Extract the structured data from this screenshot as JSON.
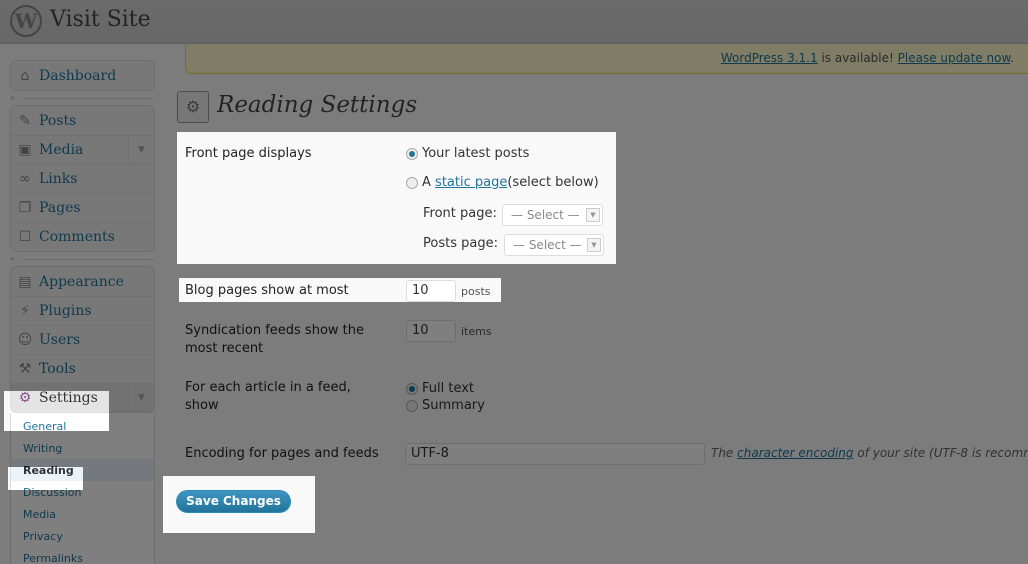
{
  "header": {
    "logo": "W",
    "site_title": "Visit Site"
  },
  "update_nag": {
    "version_link": "WordPress 3.1.1",
    "middle_text": " is available! ",
    "update_link": "Please update now",
    "end": "."
  },
  "sidebar": {
    "dashboard": {
      "label": "Dashboard",
      "icon": "⌂"
    },
    "group1": [
      {
        "label": "Posts",
        "icon": "✎"
      },
      {
        "label": "Media",
        "icon": "▣",
        "arrow": "▼"
      },
      {
        "label": "Links",
        "icon": "∞"
      },
      {
        "label": "Pages",
        "icon": "❐"
      },
      {
        "label": "Comments",
        "icon": "☐"
      }
    ],
    "group2": [
      {
        "label": "Appearance",
        "icon": "▤"
      },
      {
        "label": "Plugins",
        "icon": "⚡"
      },
      {
        "label": "Users",
        "icon": "☺"
      },
      {
        "label": "Tools",
        "icon": "⚒"
      },
      {
        "label": "Settings",
        "icon": "⚙",
        "arrow": "▼"
      }
    ],
    "settings_sub": [
      "General",
      "Writing",
      "Reading",
      "Discussion",
      "Media",
      "Privacy",
      "Permalinks"
    ],
    "collapse_glyph": "«"
  },
  "page": {
    "icon": "⚙",
    "title": "Reading Settings"
  },
  "form": {
    "front_page_label": "Front page displays",
    "opt_latest": "Your latest posts",
    "opt_static_prefix": "A ",
    "opt_static_link": "static page",
    "opt_static_suffix": " (select below)",
    "front_page_select_label": "Front page:",
    "posts_page_select_label": "Posts page:",
    "select_placeholder": "— Select —",
    "dd_glyph": "▼",
    "blog_pages_label": "Blog pages show at most",
    "blog_pages_value": "10",
    "blog_pages_unit": "posts",
    "syndication_label_1": "Syndication feeds show the",
    "syndication_label_2": "most recent",
    "syndication_value": "10",
    "syndication_unit": "items",
    "feed_article_label_1": "For each article in a feed,",
    "feed_article_label_2": "show",
    "opt_full_text": "Full text",
    "opt_summary": "Summary",
    "encoding_label": "Encoding for pages and feeds",
    "encoding_value": "UTF-8",
    "encoding_desc_prefix": "The ",
    "encoding_desc_link": "character encoding",
    "encoding_desc_suffix": " of your site (UTF-8 is recomm",
    "save_label": "Save Changes"
  }
}
